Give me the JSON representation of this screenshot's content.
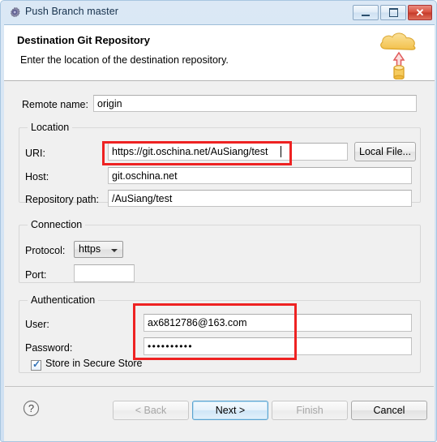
{
  "window": {
    "title": "Push Branch master",
    "icon": "gear-icon",
    "controls": {
      "minimize": "Minimize",
      "maximize": "Maximize",
      "close": "✕"
    }
  },
  "header": {
    "title": "Destination Git Repository",
    "subtitle": "Enter the location of the destination repository.",
    "icon": "cloud-upload-icon"
  },
  "form": {
    "remote_name_label": "Remote name:",
    "remote_name_value": "origin",
    "location": {
      "group_label": "Location",
      "uri_label": "URI:",
      "uri_value": "https://git.oschina.net/AuSiang/test",
      "host_label": "Host:",
      "host_value": "git.oschina.net",
      "repo_path_label": "Repository path:",
      "repo_path_value": "/AuSiang/test",
      "local_file_button": "Local File..."
    },
    "connection": {
      "group_label": "Connection",
      "protocol_label": "Protocol:",
      "protocol_value": "https",
      "port_label": "Port:",
      "port_value": ""
    },
    "authentication": {
      "group_label": "Authentication",
      "user_label": "User:",
      "user_value": "ax6812786@163.com",
      "password_label": "Password:",
      "password_value": "••••••••••",
      "store_secure_label": "Store in Secure Store",
      "store_secure_checked": true,
      "check_mark": "✓"
    }
  },
  "footer": {
    "help_icon": "question-mark-icon",
    "back_label": "< Back",
    "back_enabled": false,
    "next_label": "Next >",
    "next_enabled": true,
    "finish_label": "Finish",
    "finish_enabled": false,
    "cancel_label": "Cancel",
    "cancel_enabled": true
  },
  "annotations": {
    "uri_highlight": "red-box-uri",
    "auth_highlight": "red-box-authentication",
    "color": "#ee2222"
  }
}
